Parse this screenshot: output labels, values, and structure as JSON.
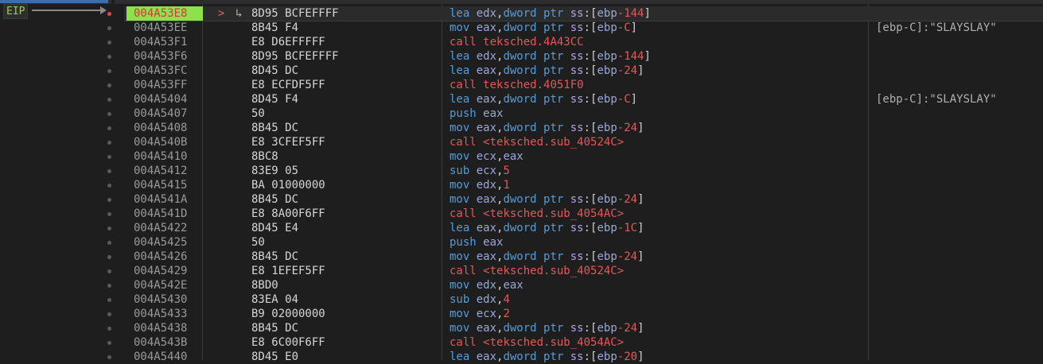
{
  "eip_label": "EIP",
  "rows": [
    {
      "addr": "004A53E8",
      "bytes": "8D95 BCFEFFFF",
      "instr": [
        [
          "mn",
          "lea "
        ],
        [
          "reg",
          "edx"
        ],
        [
          "punct",
          ","
        ],
        [
          "mn",
          "dword ptr "
        ],
        [
          "seg",
          "ss"
        ],
        [
          "punct",
          ":["
        ],
        [
          "reg",
          "ebp"
        ],
        [
          "num",
          "-144"
        ],
        [
          "punct",
          "]"
        ]
      ],
      "comment": "",
      "current": true,
      "jump_marker": ">",
      "arrow": "↳"
    },
    {
      "addr": "004A53EE",
      "bytes": "8B45 F4",
      "instr": [
        [
          "mn",
          "mov "
        ],
        [
          "reg",
          "eax"
        ],
        [
          "punct",
          ","
        ],
        [
          "mn",
          "dword ptr "
        ],
        [
          "seg",
          "ss"
        ],
        [
          "punct",
          ":["
        ],
        [
          "reg",
          "ebp"
        ],
        [
          "num",
          "-C"
        ],
        [
          "punct",
          "]"
        ]
      ],
      "comment": "[ebp-C]:\"SLAYSLAY\""
    },
    {
      "addr": "004A53F1",
      "bytes": "E8 D6EFFFFF",
      "instr": [
        [
          "mn-call",
          "call "
        ],
        [
          "target",
          "teksched.4A43CC"
        ]
      ],
      "comment": ""
    },
    {
      "addr": "004A53F6",
      "bytes": "8D95 BCFEFFFF",
      "instr": [
        [
          "mn",
          "lea "
        ],
        [
          "reg",
          "edx"
        ],
        [
          "punct",
          ","
        ],
        [
          "mn",
          "dword ptr "
        ],
        [
          "seg",
          "ss"
        ],
        [
          "punct",
          ":["
        ],
        [
          "reg",
          "ebp"
        ],
        [
          "num",
          "-144"
        ],
        [
          "punct",
          "]"
        ]
      ],
      "comment": ""
    },
    {
      "addr": "004A53FC",
      "bytes": "8D45 DC",
      "instr": [
        [
          "mn",
          "lea "
        ],
        [
          "reg",
          "eax"
        ],
        [
          "punct",
          ","
        ],
        [
          "mn",
          "dword ptr "
        ],
        [
          "seg",
          "ss"
        ],
        [
          "punct",
          ":["
        ],
        [
          "reg",
          "ebp"
        ],
        [
          "num",
          "-24"
        ],
        [
          "punct",
          "]"
        ]
      ],
      "comment": ""
    },
    {
      "addr": "004A53FF",
      "bytes": "E8 ECFDF5FF",
      "instr": [
        [
          "mn-call",
          "call "
        ],
        [
          "target",
          "teksched.4051F0"
        ]
      ],
      "comment": ""
    },
    {
      "addr": "004A5404",
      "bytes": "8D45 F4",
      "instr": [
        [
          "mn",
          "lea "
        ],
        [
          "reg",
          "eax"
        ],
        [
          "punct",
          ","
        ],
        [
          "mn",
          "dword ptr "
        ],
        [
          "seg",
          "ss"
        ],
        [
          "punct",
          ":["
        ],
        [
          "reg",
          "ebp"
        ],
        [
          "num",
          "-C"
        ],
        [
          "punct",
          "]"
        ]
      ],
      "comment": "[ebp-C]:\"SLAYSLAY\""
    },
    {
      "addr": "004A5407",
      "bytes": "50",
      "instr": [
        [
          "mn",
          "push "
        ],
        [
          "reg",
          "eax"
        ]
      ],
      "comment": ""
    },
    {
      "addr": "004A5408",
      "bytes": "8B45 DC",
      "instr": [
        [
          "mn",
          "mov "
        ],
        [
          "reg",
          "eax"
        ],
        [
          "punct",
          ","
        ],
        [
          "mn",
          "dword ptr "
        ],
        [
          "seg",
          "ss"
        ],
        [
          "punct",
          ":["
        ],
        [
          "reg",
          "ebp"
        ],
        [
          "num",
          "-24"
        ],
        [
          "punct",
          "]"
        ]
      ],
      "comment": ""
    },
    {
      "addr": "004A540B",
      "bytes": "E8 3CFEF5FF",
      "instr": [
        [
          "mn-call",
          "call "
        ],
        [
          "target",
          "<teksched.sub_40524C>"
        ]
      ],
      "comment": ""
    },
    {
      "addr": "004A5410",
      "bytes": "8BC8",
      "instr": [
        [
          "mn",
          "mov "
        ],
        [
          "reg",
          "ecx"
        ],
        [
          "punct",
          ","
        ],
        [
          "reg",
          "eax"
        ]
      ],
      "comment": ""
    },
    {
      "addr": "004A5412",
      "bytes": "83E9 05",
      "instr": [
        [
          "mn",
          "sub "
        ],
        [
          "reg",
          "ecx"
        ],
        [
          "punct",
          ","
        ],
        [
          "num",
          "5"
        ]
      ],
      "comment": ""
    },
    {
      "addr": "004A5415",
      "bytes": "BA 01000000",
      "instr": [
        [
          "mn",
          "mov "
        ],
        [
          "reg",
          "edx"
        ],
        [
          "punct",
          ","
        ],
        [
          "num",
          "1"
        ]
      ],
      "comment": ""
    },
    {
      "addr": "004A541A",
      "bytes": "8B45 DC",
      "instr": [
        [
          "mn",
          "mov "
        ],
        [
          "reg",
          "eax"
        ],
        [
          "punct",
          ","
        ],
        [
          "mn",
          "dword ptr "
        ],
        [
          "seg",
          "ss"
        ],
        [
          "punct",
          ":["
        ],
        [
          "reg",
          "ebp"
        ],
        [
          "num",
          "-24"
        ],
        [
          "punct",
          "]"
        ]
      ],
      "comment": ""
    },
    {
      "addr": "004A541D",
      "bytes": "E8 8A00F6FF",
      "instr": [
        [
          "mn-call",
          "call "
        ],
        [
          "target",
          "<teksched.sub_4054AC>"
        ]
      ],
      "comment": ""
    },
    {
      "addr": "004A5422",
      "bytes": "8D45 E4",
      "instr": [
        [
          "mn",
          "lea "
        ],
        [
          "reg",
          "eax"
        ],
        [
          "punct",
          ","
        ],
        [
          "mn",
          "dword ptr "
        ],
        [
          "seg",
          "ss"
        ],
        [
          "punct",
          ":["
        ],
        [
          "reg",
          "ebp"
        ],
        [
          "num",
          "-1C"
        ],
        [
          "punct",
          "]"
        ]
      ],
      "comment": ""
    },
    {
      "addr": "004A5425",
      "bytes": "50",
      "instr": [
        [
          "mn",
          "push "
        ],
        [
          "reg",
          "eax"
        ]
      ],
      "comment": ""
    },
    {
      "addr": "004A5426",
      "bytes": "8B45 DC",
      "instr": [
        [
          "mn",
          "mov "
        ],
        [
          "reg",
          "eax"
        ],
        [
          "punct",
          ","
        ],
        [
          "mn",
          "dword ptr "
        ],
        [
          "seg",
          "ss"
        ],
        [
          "punct",
          ":["
        ],
        [
          "reg",
          "ebp"
        ],
        [
          "num",
          "-24"
        ],
        [
          "punct",
          "]"
        ]
      ],
      "comment": ""
    },
    {
      "addr": "004A5429",
      "bytes": "E8 1EFEF5FF",
      "instr": [
        [
          "mn-call",
          "call "
        ],
        [
          "target",
          "<teksched.sub_40524C>"
        ]
      ],
      "comment": ""
    },
    {
      "addr": "004A542E",
      "bytes": "8BD0",
      "instr": [
        [
          "mn",
          "mov "
        ],
        [
          "reg",
          "edx"
        ],
        [
          "punct",
          ","
        ],
        [
          "reg",
          "eax"
        ]
      ],
      "comment": ""
    },
    {
      "addr": "004A5430",
      "bytes": "83EA 04",
      "instr": [
        [
          "mn",
          "sub "
        ],
        [
          "reg",
          "edx"
        ],
        [
          "punct",
          ","
        ],
        [
          "num",
          "4"
        ]
      ],
      "comment": ""
    },
    {
      "addr": "004A5433",
      "bytes": "B9 02000000",
      "instr": [
        [
          "mn",
          "mov "
        ],
        [
          "reg",
          "ecx"
        ],
        [
          "punct",
          ","
        ],
        [
          "num",
          "2"
        ]
      ],
      "comment": ""
    },
    {
      "addr": "004A5438",
      "bytes": "8B45 DC",
      "instr": [
        [
          "mn",
          "mov "
        ],
        [
          "reg",
          "eax"
        ],
        [
          "punct",
          ","
        ],
        [
          "mn",
          "dword ptr "
        ],
        [
          "seg",
          "ss"
        ],
        [
          "punct",
          ":["
        ],
        [
          "reg",
          "ebp"
        ],
        [
          "num",
          "-24"
        ],
        [
          "punct",
          "]"
        ]
      ],
      "comment": ""
    },
    {
      "addr": "004A543B",
      "bytes": "E8 6C00F6FF",
      "instr": [
        [
          "mn-call",
          "call "
        ],
        [
          "target",
          "<teksched.sub_4054AC>"
        ]
      ],
      "comment": ""
    },
    {
      "addr": "004A5440",
      "bytes": "8D45 E0",
      "instr": [
        [
          "mn",
          "lea "
        ],
        [
          "reg",
          "eax"
        ],
        [
          "punct",
          ","
        ],
        [
          "mn",
          "dword ptr "
        ],
        [
          "seg",
          "ss"
        ],
        [
          "punct",
          ":["
        ],
        [
          "reg",
          "ebp"
        ],
        [
          "num",
          "-20"
        ],
        [
          "punct",
          "]"
        ]
      ],
      "comment": ""
    }
  ],
  "colors": {
    "background": "#1e1e1e",
    "current_addr_bg": "#8ee04c",
    "current_addr_fg": "#d23a3a",
    "eip_label": "#8fd14f",
    "breakpoint_current": "#e04848",
    "breakpoint_normal": "#5a5a5a"
  }
}
